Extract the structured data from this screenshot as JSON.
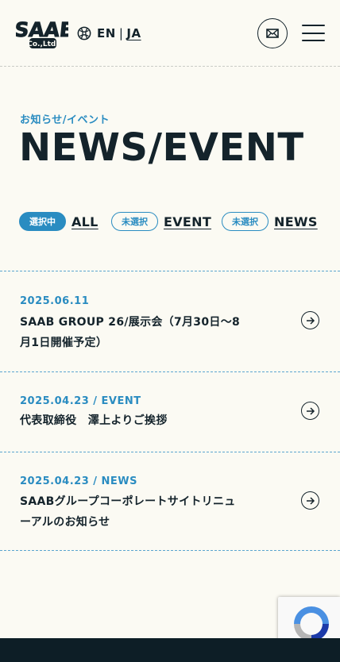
{
  "header": {
    "logo_text": "SAAB",
    "logo_sub": "Co.,Ltd.",
    "lang_en": "EN",
    "lang_sep": "|",
    "lang_ja": "JA"
  },
  "page": {
    "subtitle": "お知らせ/イベント",
    "title": "NEWS/EVENT"
  },
  "filters": [
    {
      "status": "選択中",
      "label": "ALL",
      "active": true
    },
    {
      "status": "未選択",
      "label": "EVENT",
      "active": false
    },
    {
      "status": "未選択",
      "label": "NEWS",
      "active": false
    }
  ],
  "news": [
    {
      "date": "2025.06.11",
      "title": "SAAB GROUP 26/展示会（7月30日〜8月1日開催予定）"
    },
    {
      "date": "2025.04.23 / EVENT",
      "title": "代表取締役　澤上よりご挨拶"
    },
    {
      "date": "2025.04.23 / NEWS",
      "title": "SAABグループコーポレートサイトリニューアルのお知らせ"
    }
  ],
  "colors": {
    "accent": "#2a8cc1",
    "text": "#14232b",
    "background": "#fbfaf3",
    "footer": "#0d1e26"
  }
}
